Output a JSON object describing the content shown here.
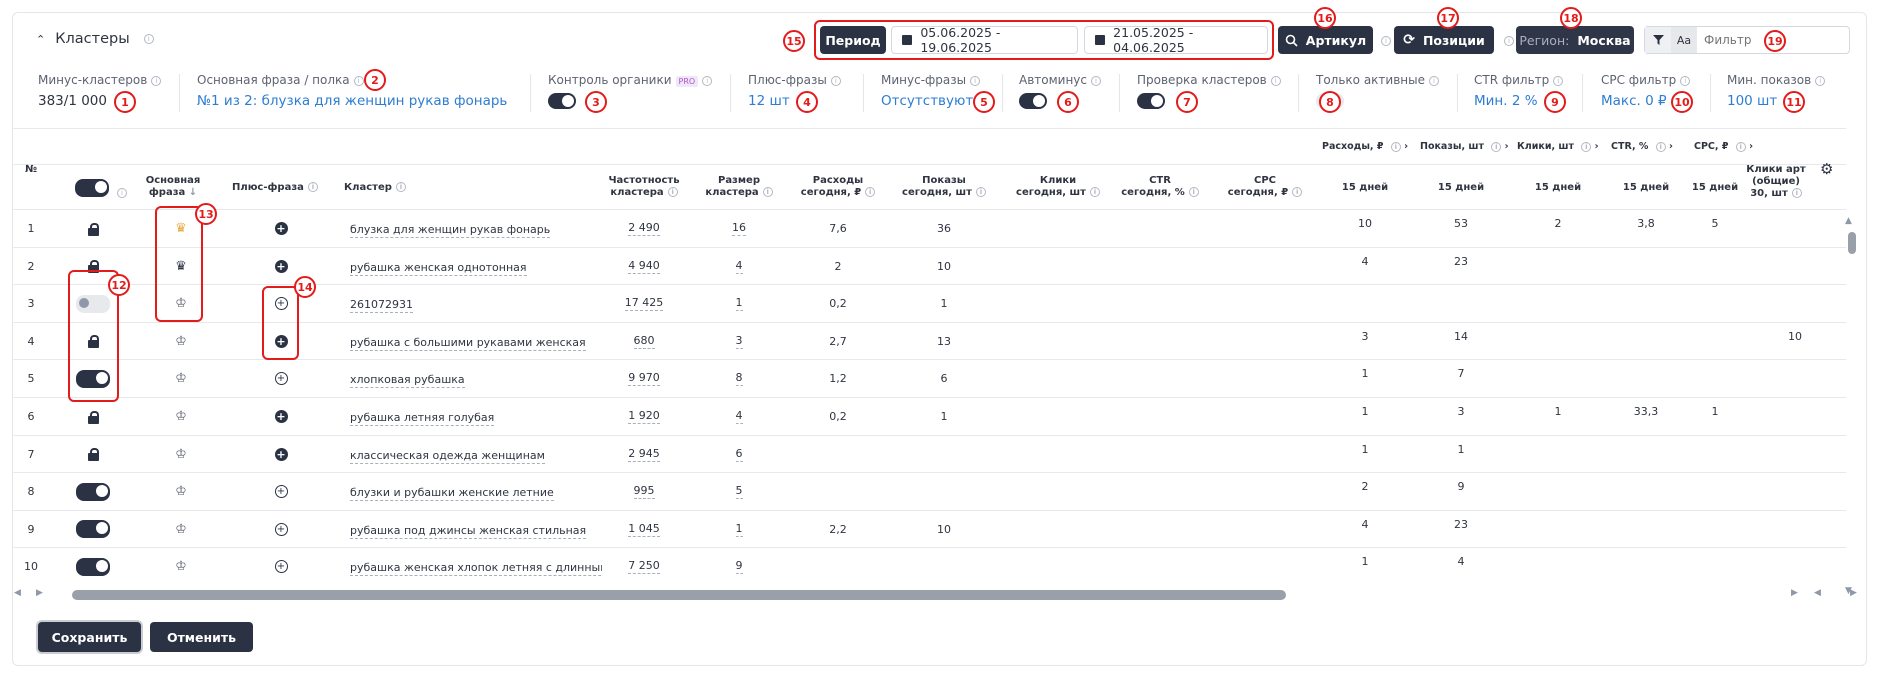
{
  "panel": {
    "title": "Кластеры"
  },
  "toolbar": {
    "period_label": "Период",
    "date_range_1": "05.06.2025 - 19.06.2025",
    "date_range_2": "21.05.2025 - 04.06.2025",
    "article_label": "Артикул",
    "positions_label": "Позиции",
    "region_prefix": "Регион:",
    "region_value": "Москва",
    "case_label": "Aa",
    "filter_placeholder": "Фильтр"
  },
  "stats": {
    "minus_clusters": {
      "label": "Минус-кластеров",
      "value": "383/1 000"
    },
    "main_phrase": {
      "label": "Основная фраза / полка",
      "value": "№1 из 2: блузка для женщин рукав фонарь"
    },
    "organic": {
      "label": "Контроль органики",
      "badge": "PRO"
    },
    "plus_phrases": {
      "label": "Плюс-фразы",
      "value": "12 шт"
    },
    "minus_phrases": {
      "label": "Минус-фразы",
      "value": "Отсутствуют"
    },
    "autominus": {
      "label": "Автоминус"
    },
    "cluster_check": {
      "label": "Проверка кластеров"
    },
    "only_active": {
      "label": "Только активные"
    },
    "ctr_filter": {
      "label": "CTR фильтр",
      "value": "Мин. 2 %"
    },
    "cpc_filter": {
      "label": "CPC фильтр",
      "value": "Макс. 0 ₽"
    },
    "min_shows": {
      "label": "Мин. показов",
      "value": "100 шт"
    }
  },
  "table": {
    "header": {
      "num": "№",
      "main_phrase_1": "Основная",
      "main_phrase_2": "фраза",
      "plus_phrase": "Плюс-фраза",
      "cluster": "Кластер",
      "freq_1": "Частотность",
      "freq_2": "кластера",
      "size_1": "Размер",
      "size_2": "кластера",
      "spend_1": "Расходы",
      "spend_2": "сегодня, ₽",
      "shows_1": "Показы",
      "shows_2": "сегодня, шт",
      "clicks_1": "Клики",
      "clicks_2": "сегодня, шт",
      "ctr_1": "CTR",
      "ctr_2": "сегодня, %",
      "cpc_1": "CPC",
      "cpc_2": "сегодня, ₽",
      "g_spend": "Расходы, ₽",
      "g_shows": "Показы, шт",
      "g_clicks": "Клики, шт",
      "g_ctr": "CTR, %",
      "g_cpc": "CPC, ₽",
      "days15": "15 дней",
      "art_clicks_1": "Клики арт",
      "art_clicks_2": "(общие)",
      "art_clicks_3": "30, шт"
    },
    "rows": [
      {
        "n": "1",
        "state": "lock",
        "crown": "gold",
        "plus": "filled",
        "cluster": "блузка для женщин рукав фонарь",
        "freq": "2 490",
        "size": "16",
        "spend": "7,6",
        "shows": "36",
        "clicks": "",
        "ctr": "",
        "cpc": "",
        "s15": "10",
        "sh15": "53",
        "c15": "2",
        "ctr15": "3,8",
        "cpc15": "5",
        "art": ""
      },
      {
        "n": "2",
        "state": "lock",
        "crown": "dark",
        "plus": "filled",
        "cluster": "рубашка женская однотонная",
        "freq": "4 940",
        "size": "4",
        "spend": "2",
        "shows": "10",
        "clicks": "",
        "ctr": "",
        "cpc": "",
        "s15": "4",
        "sh15": "23",
        "c15": "",
        "ctr15": "",
        "cpc15": "",
        "art": ""
      },
      {
        "n": "3",
        "state": "off",
        "crown": "outline",
        "plus": "outline",
        "cluster": "261072931",
        "freq": "17 425",
        "size": "1",
        "spend": "0,2",
        "shows": "1",
        "clicks": "",
        "ctr": "",
        "cpc": "",
        "s15": "",
        "sh15": "",
        "c15": "",
        "ctr15": "",
        "cpc15": "",
        "art": ""
      },
      {
        "n": "4",
        "state": "lock",
        "crown": "outline",
        "plus": "filled",
        "cluster": "рубашка с большими рукавами женская",
        "freq": "680",
        "size": "3",
        "spend": "2,7",
        "shows": "13",
        "clicks": "",
        "ctr": "",
        "cpc": "",
        "s15": "3",
        "sh15": "14",
        "c15": "",
        "ctr15": "",
        "cpc15": "",
        "art": "10"
      },
      {
        "n": "5",
        "state": "on",
        "crown": "outline",
        "plus": "outline",
        "cluster": "хлопковая рубашка",
        "freq": "9 970",
        "size": "8",
        "spend": "1,2",
        "shows": "6",
        "clicks": "",
        "ctr": "",
        "cpc": "",
        "s15": "1",
        "sh15": "7",
        "c15": "",
        "ctr15": "",
        "cpc15": "",
        "art": ""
      },
      {
        "n": "6",
        "state": "lock",
        "crown": "outline",
        "plus": "filled",
        "cluster": "рубашка летняя голубая",
        "freq": "1 920",
        "size": "4",
        "spend": "0,2",
        "shows": "1",
        "clicks": "",
        "ctr": "",
        "cpc": "",
        "s15": "1",
        "sh15": "3",
        "c15": "1",
        "ctr15": "33,3",
        "cpc15": "1",
        "art": ""
      },
      {
        "n": "7",
        "state": "lock",
        "crown": "outline",
        "plus": "filled",
        "cluster": "классическая одежда женщинам",
        "freq": "2 945",
        "size": "6",
        "spend": "",
        "shows": "",
        "clicks": "",
        "ctr": "",
        "cpc": "",
        "s15": "1",
        "sh15": "1",
        "c15": "",
        "ctr15": "",
        "cpc15": "",
        "art": ""
      },
      {
        "n": "8",
        "state": "on",
        "crown": "outline",
        "plus": "outline",
        "cluster": "блузки и рубашки женские летние",
        "freq": "995",
        "size": "5",
        "spend": "",
        "shows": "",
        "clicks": "",
        "ctr": "",
        "cpc": "",
        "s15": "2",
        "sh15": "9",
        "c15": "",
        "ctr15": "",
        "cpc15": "",
        "art": ""
      },
      {
        "n": "9",
        "state": "on",
        "crown": "outline",
        "plus": "outline",
        "cluster": "рубашка под джинсы женская стильная",
        "freq": "1 045",
        "size": "1",
        "spend": "2,2",
        "shows": "10",
        "clicks": "",
        "ctr": "",
        "cpc": "",
        "s15": "4",
        "sh15": "23",
        "c15": "",
        "ctr15": "",
        "cpc15": "",
        "art": ""
      },
      {
        "n": "10",
        "state": "on",
        "crown": "outline",
        "plus": "outline",
        "cluster": "рубашка женская хлопок летняя с длинным ру",
        "freq": "7 250",
        "size": "9",
        "spend": "",
        "shows": "",
        "clicks": "",
        "ctr": "",
        "cpc": "",
        "s15": "1",
        "sh15": "4",
        "c15": "",
        "ctr15": "",
        "cpc15": "",
        "art": ""
      }
    ]
  },
  "footer": {
    "save_label": "Сохранить",
    "cancel_label": "Отменить"
  },
  "annotations": [
    "1",
    "2",
    "3",
    "4",
    "5",
    "6",
    "7",
    "8",
    "9",
    "10",
    "11",
    "12",
    "13",
    "14",
    "15",
    "16",
    "17",
    "18",
    "19"
  ]
}
